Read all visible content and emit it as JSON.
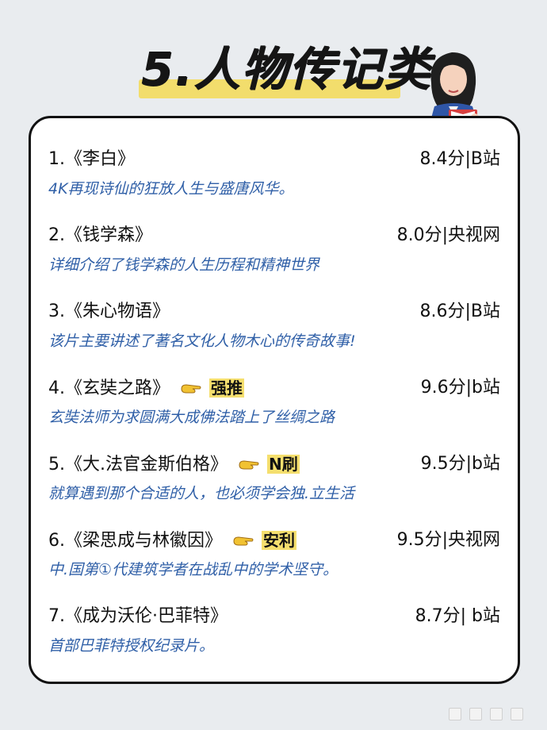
{
  "page": {
    "title": "5.人物传记类"
  },
  "items": [
    {
      "num": "1.",
      "title": "《李白》",
      "tag": "",
      "score": "8.4分|B站",
      "desc": "4K再现诗仙的狂放人生与盛唐风华。"
    },
    {
      "num": "2.",
      "title": "《钱学森》",
      "tag": "",
      "score": "8.0分|央视网",
      "desc": "详细介绍了钱学森的人生历程和精神世界"
    },
    {
      "num": "3.",
      "title": "《朱心物语》",
      "tag": "",
      "score": "8.6分|B站",
      "desc": "该片主要讲述了著名文化人物木心的传奇故事!"
    },
    {
      "num": "4.",
      "title": "《玄奘之路》",
      "tag": "强推",
      "score": "9.6分|b站",
      "desc": "玄奘法师为求圆满大成佛法踏上了丝绸之路"
    },
    {
      "num": "5.",
      "title": "《大.法官金斯伯格》",
      "tag": "N刷",
      "score": "9.5分|b站",
      "desc": "就算遇到那个合适的人，也必须学会独.立生活"
    },
    {
      "num": "6.",
      "title": "《梁思成与林徽因》",
      "tag": "安利",
      "score": "9.5分|央视网",
      "desc": "中.国第①代建筑学者在战乱中的学术坚守。"
    },
    {
      "num": "7.",
      "title": "《成为沃伦·巴菲特》",
      "tag": "",
      "score": "8.7分| b站",
      "desc": "首部巴菲特授权纪录片。"
    }
  ],
  "colors": {
    "background": "#e9ecef",
    "description": "#2f5fa7",
    "tag_highlight": "#f5df6e"
  },
  "icons": {
    "pointer": "pointing-hand-icon",
    "illustration": "woman-reading-book-illustration"
  }
}
